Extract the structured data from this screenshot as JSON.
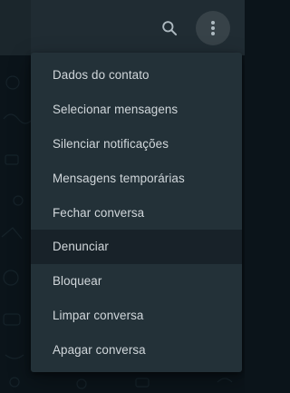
{
  "header": {
    "search_icon": "search-icon",
    "menu_icon": "more-vertical-icon"
  },
  "menu": {
    "items": [
      {
        "label": "Dados do contato"
      },
      {
        "label": "Selecionar mensagens"
      },
      {
        "label": "Silenciar notificações"
      },
      {
        "label": "Mensagens temporárias"
      },
      {
        "label": "Fechar conversa"
      },
      {
        "label": "Denunciar",
        "highlighted": true
      },
      {
        "label": "Bloquear"
      },
      {
        "label": "Limpar conversa"
      },
      {
        "label": "Apagar conversa"
      }
    ]
  },
  "colors": {
    "header_bg": "#202c33",
    "chat_bg": "#0b141a",
    "menu_bg": "#233138",
    "menu_hover": "#182229",
    "text": "#d1d7db",
    "icon": "#aebac1"
  }
}
